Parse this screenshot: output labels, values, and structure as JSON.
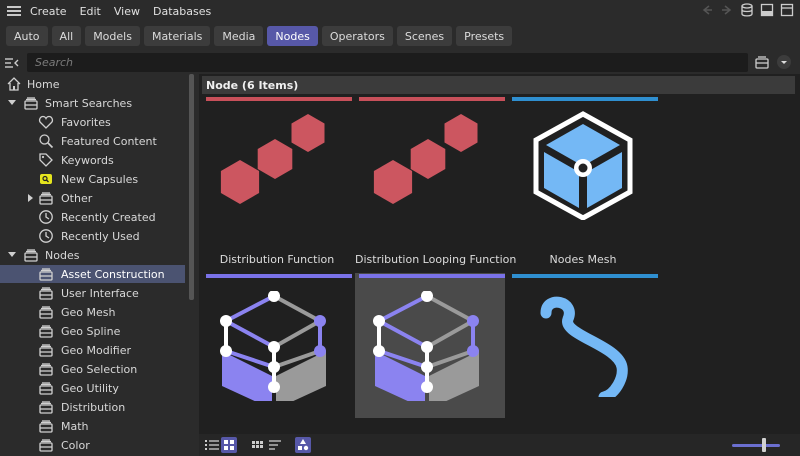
{
  "menu": {
    "items": [
      "Create",
      "Edit",
      "View",
      "Databases"
    ]
  },
  "filters": [
    {
      "label": "Auto",
      "active": false
    },
    {
      "label": "All",
      "active": false
    },
    {
      "label": "Models",
      "active": false
    },
    {
      "label": "Materials",
      "active": false
    },
    {
      "label": "Media",
      "active": false
    },
    {
      "label": "Nodes",
      "active": true
    },
    {
      "label": "Operators",
      "active": false
    },
    {
      "label": "Scenes",
      "active": false
    },
    {
      "label": "Presets",
      "active": false
    }
  ],
  "search": {
    "placeholder": "Search",
    "value": ""
  },
  "sidebar": {
    "items": [
      {
        "label": "Home",
        "level": 0,
        "icon": "home-icon",
        "arrow": "none",
        "selected": false
      },
      {
        "label": "Smart Searches",
        "level": 0,
        "icon": "folder-stack-icon",
        "arrow": "down",
        "selected": false
      },
      {
        "label": "Favorites",
        "level": 1,
        "icon": "heart-icon",
        "arrow": "none",
        "selected": false
      },
      {
        "label": "Featured Content",
        "level": 1,
        "icon": "search-icon",
        "arrow": "none",
        "selected": false
      },
      {
        "label": "Keywords",
        "level": 1,
        "icon": "tag-icon",
        "arrow": "none",
        "selected": false
      },
      {
        "label": "New Capsules",
        "level": 1,
        "icon": "capsule-badge-icon",
        "arrow": "none",
        "selected": false
      },
      {
        "label": "Other",
        "level": 1,
        "icon": "folder-stack-icon",
        "arrow": "right",
        "selected": false
      },
      {
        "label": "Recently Created",
        "level": 1,
        "icon": "clock-icon",
        "arrow": "none",
        "selected": false
      },
      {
        "label": "Recently Used",
        "level": 1,
        "icon": "clock-icon",
        "arrow": "none",
        "selected": false
      },
      {
        "label": "Nodes",
        "level": 0,
        "icon": "folder-stack-icon",
        "arrow": "down",
        "selected": false
      },
      {
        "label": "Asset Construction",
        "level": 1,
        "icon": "folder-stack-icon",
        "arrow": "none",
        "selected": true
      },
      {
        "label": "User Interface",
        "level": 1,
        "icon": "folder-stack-icon",
        "arrow": "none",
        "selected": false
      },
      {
        "label": "Geo Mesh",
        "level": 1,
        "icon": "folder-stack-icon",
        "arrow": "none",
        "selected": false
      },
      {
        "label": "Geo Spline",
        "level": 1,
        "icon": "folder-stack-icon",
        "arrow": "none",
        "selected": false
      },
      {
        "label": "Geo Modifier",
        "level": 1,
        "icon": "folder-stack-icon",
        "arrow": "none",
        "selected": false
      },
      {
        "label": "Geo Selection",
        "level": 1,
        "icon": "folder-stack-icon",
        "arrow": "none",
        "selected": false
      },
      {
        "label": "Geo Utility",
        "level": 1,
        "icon": "folder-stack-icon",
        "arrow": "none",
        "selected": false
      },
      {
        "label": "Distribution",
        "level": 1,
        "icon": "folder-stack-icon",
        "arrow": "none",
        "selected": false
      },
      {
        "label": "Math",
        "level": 1,
        "icon": "folder-stack-icon",
        "arrow": "none",
        "selected": false
      },
      {
        "label": "Color",
        "level": 1,
        "icon": "folder-stack-icon",
        "arrow": "none",
        "selected": false
      }
    ]
  },
  "content": {
    "header": "Node (6 Items)",
    "tiles": [
      {
        "label": "Distribution Function",
        "thumb": "distribution",
        "bar_color": "#c8505a",
        "selected": false
      },
      {
        "label": "Distribution Looping Function",
        "thumb": "distribution",
        "bar_color": "#c8505a",
        "selected": false
      },
      {
        "label": "Nodes Mesh",
        "thumb": "nodes-mesh",
        "bar_color": "#2f8fd0",
        "selected": false
      },
      {
        "label": "",
        "thumb": "graph-cube",
        "bar_color": "#7a72e8",
        "selected": false
      },
      {
        "label": "",
        "thumb": "graph-cube",
        "bar_color": "#7a72e8",
        "selected": true
      },
      {
        "label": "",
        "thumb": "spline",
        "bar_color": "#2f8fd0",
        "selected": false
      }
    ]
  },
  "colors": {
    "accent": "#5758a8",
    "distribution_red": "#cc5660",
    "mesh_blue": "#74b8f5",
    "graph_purple": "#8b83f0"
  },
  "bottombar": {
    "slider_value": 0.6
  }
}
